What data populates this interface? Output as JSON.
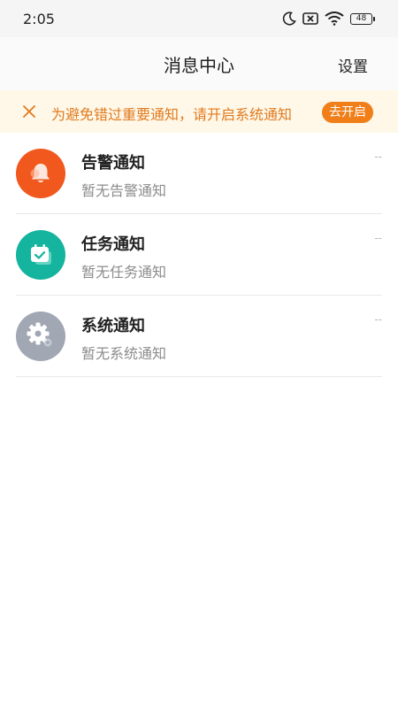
{
  "status_bar": {
    "time": "2:05",
    "battery": "48",
    "icons": [
      "moon-icon",
      "sim-blocked-icon",
      "wifi-icon",
      "battery-icon"
    ]
  },
  "header": {
    "title": "消息中心",
    "settings_label": "设置"
  },
  "notice": {
    "text": "为避免错过重要通知，请开启系统通知",
    "button_label": "去开启",
    "close_icon": "close-icon",
    "color": "#e07a1f",
    "background": "#fff8e8"
  },
  "messages": [
    {
      "title": "告警通知",
      "subtitle": "暂无告警通知",
      "time": "--",
      "icon": "bell-icon",
      "color": "#f0581e"
    },
    {
      "title": "任务通知",
      "subtitle": "暂无任务通知",
      "time": "--",
      "icon": "calendar-check-icon",
      "color": "#14b49e"
    },
    {
      "title": "系统通知",
      "subtitle": "暂无系统通知",
      "time": "--",
      "icon": "gear-icon",
      "color": "#a1a7b3"
    }
  ]
}
